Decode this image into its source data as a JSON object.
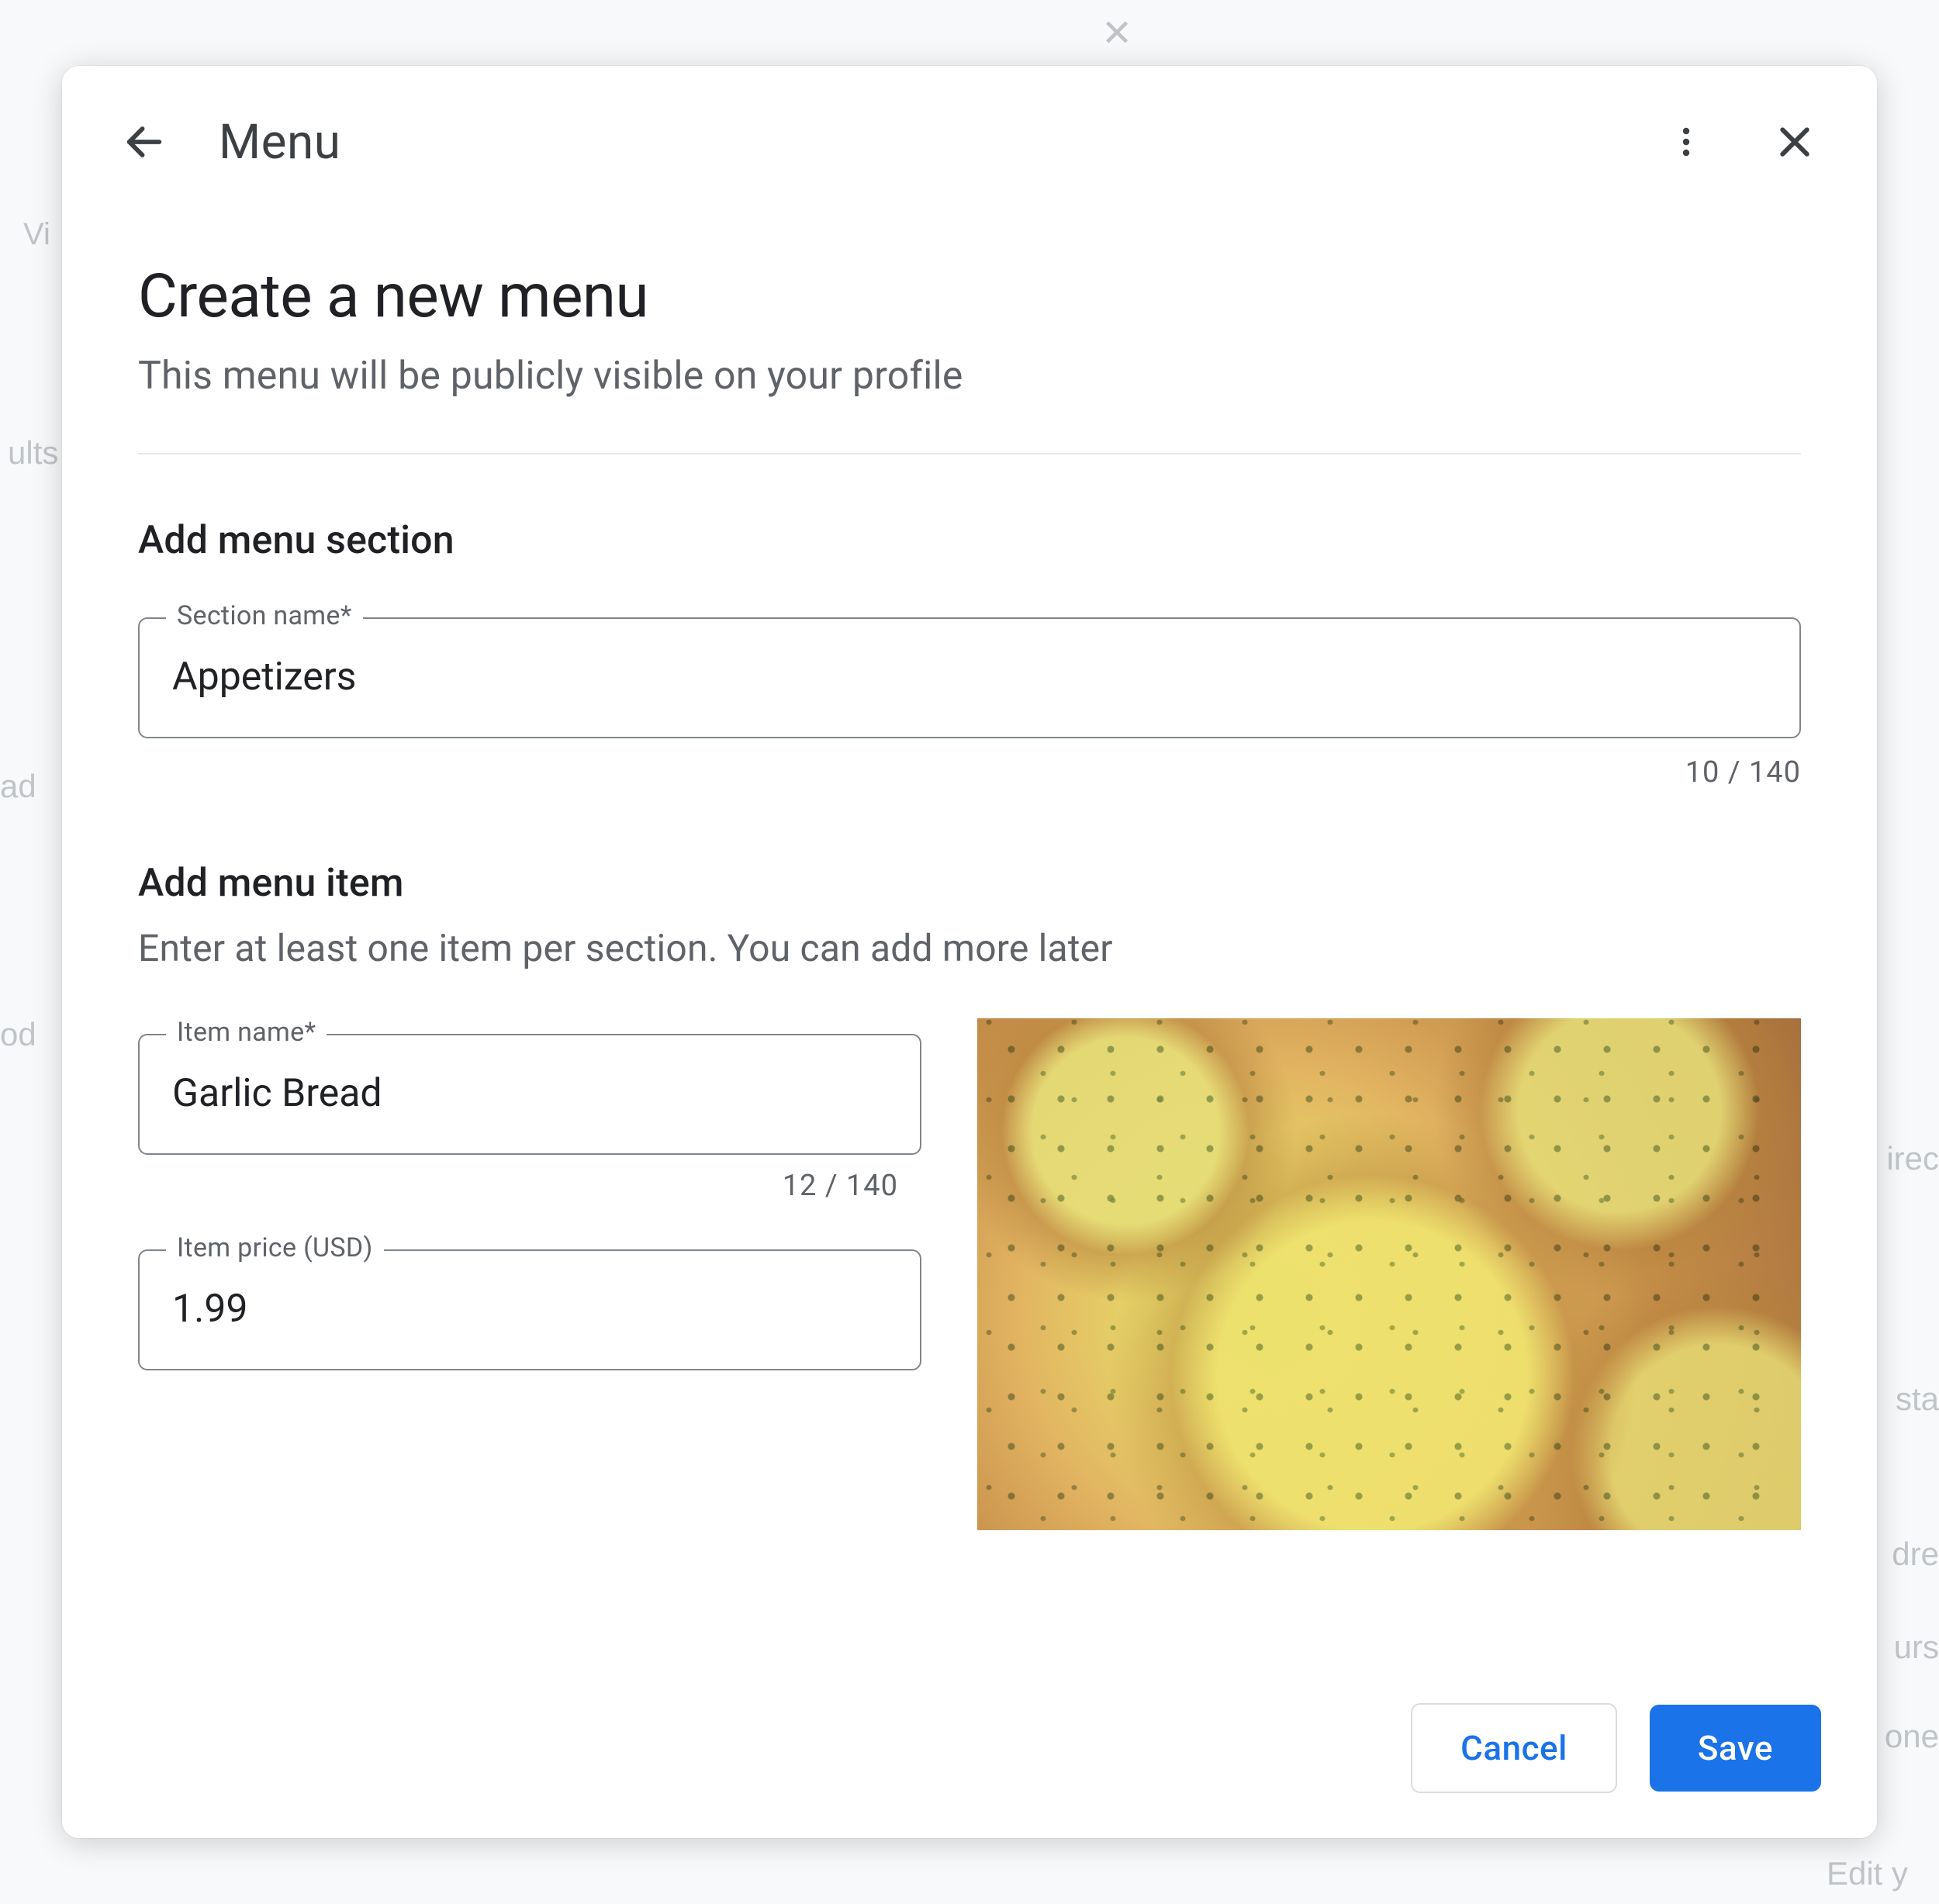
{
  "header": {
    "title": "Menu"
  },
  "page": {
    "heading": "Create a new menu",
    "subheading": "This menu will be publicly visible on your profile"
  },
  "section": {
    "heading": "Add menu section",
    "name_label": "Section name*",
    "name_value": "Appetizers",
    "name_counter": "10 / 140"
  },
  "item": {
    "heading": "Add menu item",
    "subheading": "Enter at least one item per section. You can add more later",
    "name_label": "Item name*",
    "name_value": "Garlic Bread",
    "name_counter": "12 / 140",
    "price_label": "Item price (USD)",
    "price_value": "1.99",
    "image_alt": "Garlic bread"
  },
  "footer": {
    "cancel": "Cancel",
    "save": "Save"
  }
}
